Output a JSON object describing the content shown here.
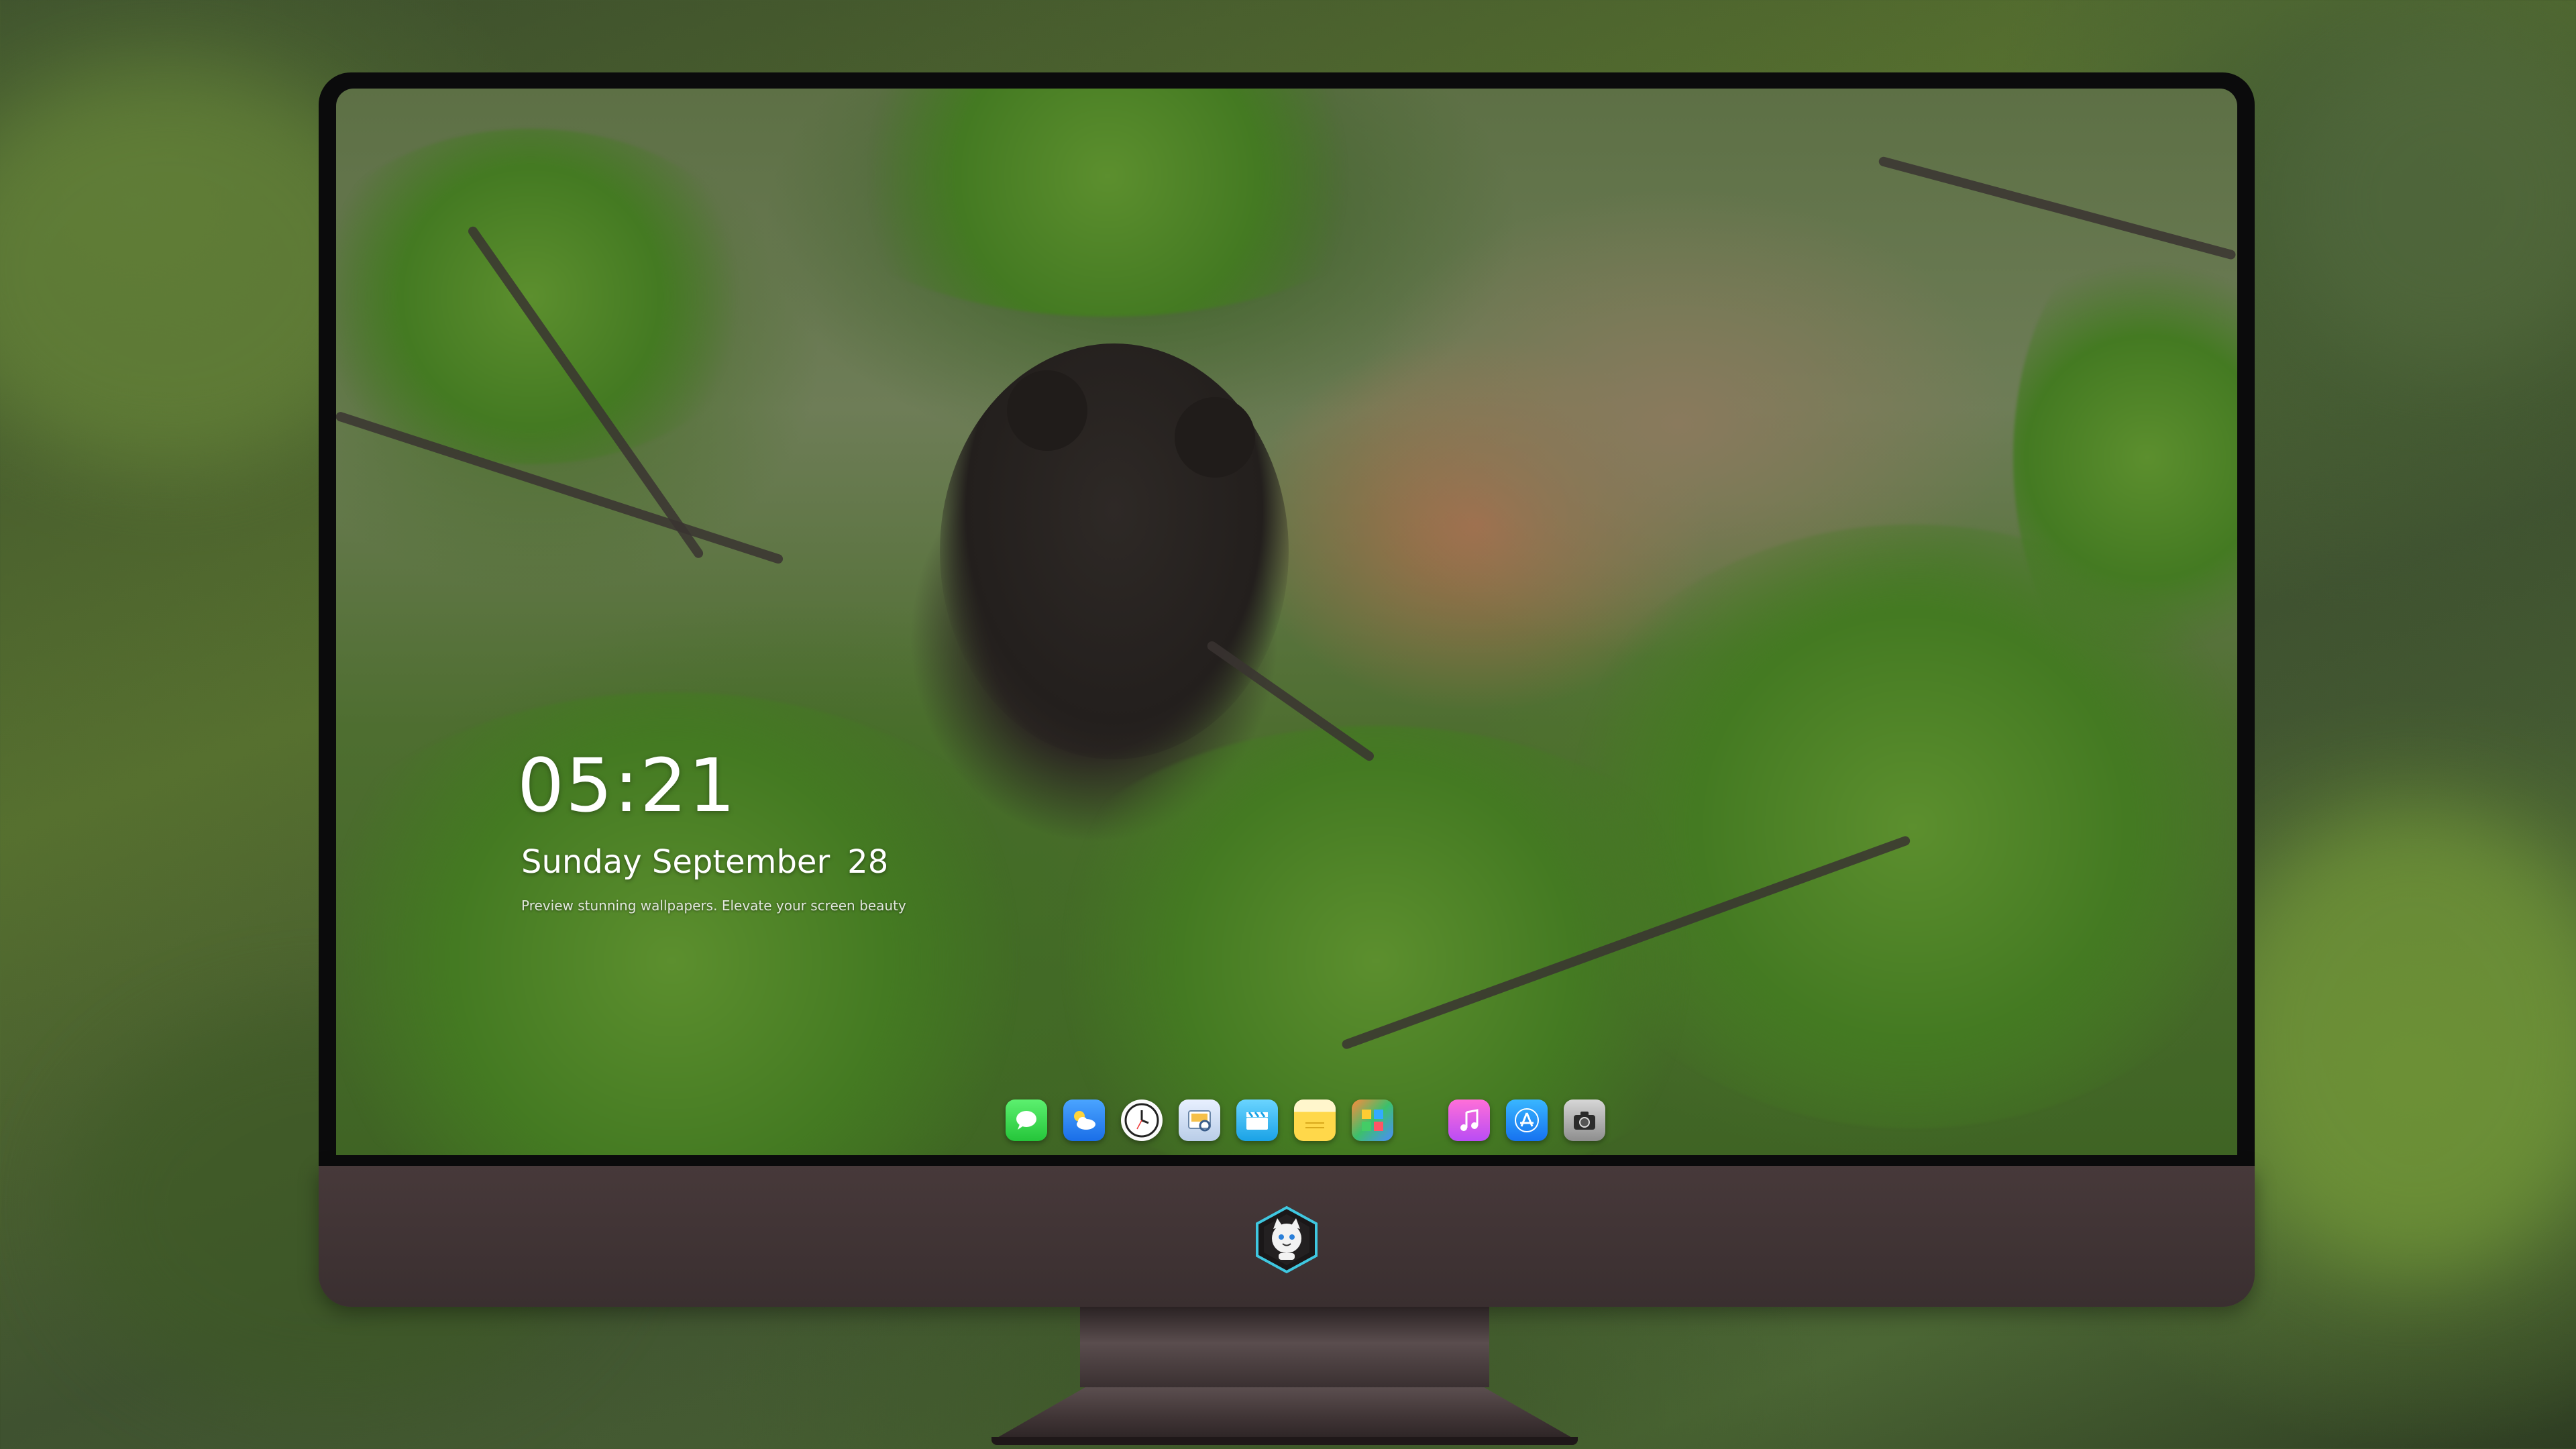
{
  "lockscreen": {
    "time": "05:21",
    "weekday_month": "Sunday September",
    "day": "28",
    "caption": "Preview stunning wallpapers. Elevate your screen beauty"
  },
  "dock": {
    "apps": [
      {
        "name": "Messages",
        "icon": "message-bubble-icon"
      },
      {
        "name": "Weather",
        "icon": "cloud-sun-icon"
      },
      {
        "name": "Clock",
        "icon": "clock-icon"
      },
      {
        "name": "Preview",
        "icon": "preview-icon"
      },
      {
        "name": "Clips",
        "icon": "clapperboard-icon"
      },
      {
        "name": "Notes",
        "icon": "notes-icon"
      },
      {
        "name": "Photo Booth",
        "icon": "photo-icon"
      },
      {
        "name": "Music",
        "icon": "music-note-icon"
      },
      {
        "name": "App Store",
        "icon": "app-store-icon"
      },
      {
        "name": "Camera",
        "icon": "camera-icon"
      }
    ]
  },
  "colors": {
    "chin": "#3e3334",
    "bezel": "#0b0b0c",
    "text": "#ffffff"
  }
}
